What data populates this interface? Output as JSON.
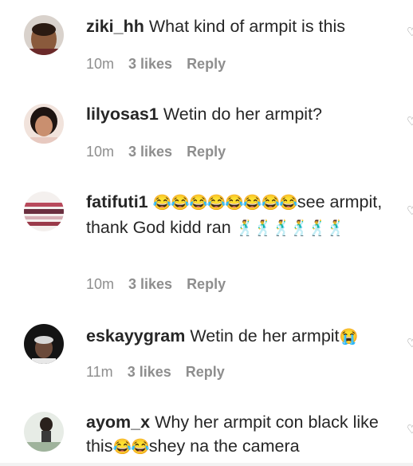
{
  "comments": [
    {
      "username": "ziki_hh",
      "text": "What kind of armpit is this",
      "time": "10m",
      "likes": "3 likes",
      "reply": "Reply",
      "avatar_color": "#a06a4a"
    },
    {
      "username": "lilyosas1",
      "text": "Wetin do her armpit?",
      "time": "10m",
      "likes": "3 likes",
      "reply": "Reply",
      "avatar_color": "#c98a6c"
    },
    {
      "username": "fatifuti1",
      "text_emoji": "😂😂😂😂😂😂😂😂",
      "text": "see armpit, thank God kidd ran",
      "text_emoji_end": "🕺🕺🕺🕺🕺🕺",
      "time": "10m",
      "likes": "3 likes",
      "reply": "Reply",
      "avatar_color": "#b84a5c"
    },
    {
      "username": "eskayygram",
      "text": "Wetin de her armpit",
      "text_emoji_end": "😭",
      "time": "11m",
      "likes": "3 likes",
      "reply": "Reply",
      "avatar_color": "#2a2a2a"
    },
    {
      "username": "ayom_x",
      "text": "Why her armpit con black like this",
      "text_emoji": "😂😂",
      "text_end": "shey na the camera",
      "avatar_color": "#9aa69a"
    }
  ],
  "icons": {
    "like": "heart-outline-icon"
  }
}
